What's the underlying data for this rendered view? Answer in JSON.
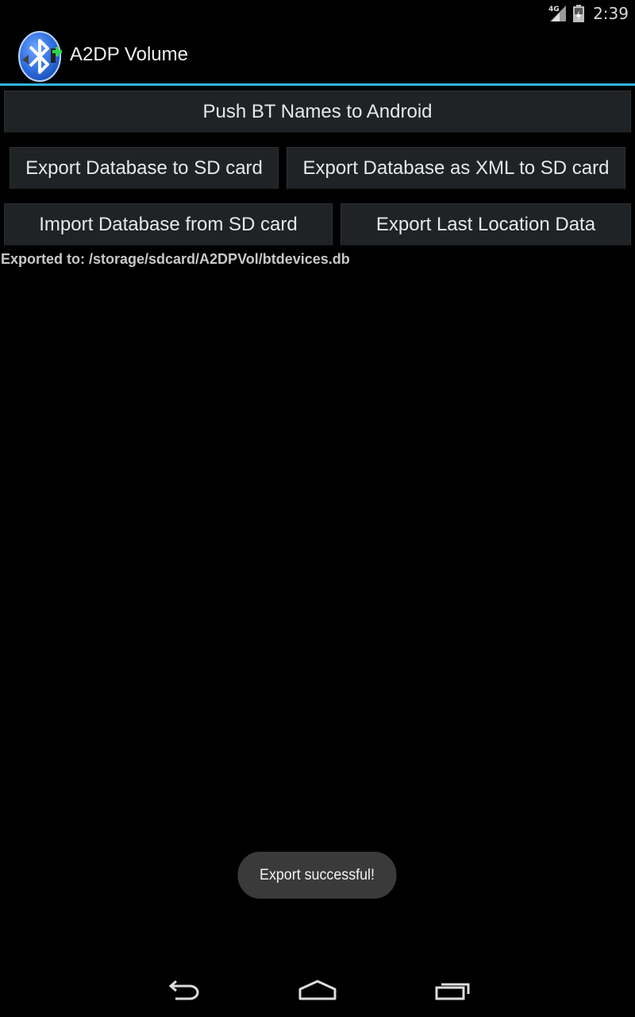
{
  "status_bar": {
    "network_label": "4G",
    "time": "2:39",
    "icons": [
      "signal-icon",
      "battery-icon"
    ]
  },
  "action_bar": {
    "title": "A2DP Volume",
    "icon": "bluetooth-app-icon",
    "accent_color": "#33b5e5"
  },
  "buttons": {
    "push_bt_names": "Push BT Names to Android",
    "export_db_sd": "Export Database to SD card",
    "export_db_xml": "Export Database as XML to SD card",
    "import_db_sd": "Import Database from SD card",
    "export_location": "Export Last Location Data"
  },
  "status_text": "Exported to: /storage/sdcard/A2DPVol/btdevices.db",
  "toast": "Export successful!",
  "nav_bar": {
    "icons": [
      "back-icon",
      "home-icon",
      "recent-apps-icon"
    ]
  }
}
